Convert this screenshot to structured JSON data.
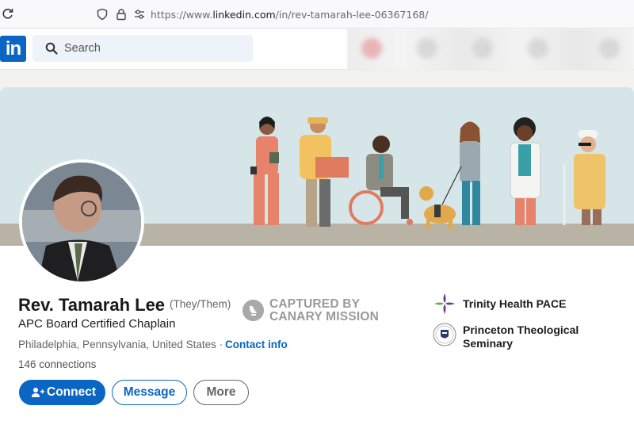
{
  "browser": {
    "url_prefix": "https://www.",
    "url_domain": "linkedin.com",
    "url_path": "/in/rev-tamarah-lee-06367168/"
  },
  "header": {
    "logo_text": "in",
    "search_placeholder": "Search",
    "brand_color": "#0a66c2"
  },
  "profile": {
    "name": "Rev. Tamarah Lee",
    "pronouns": "(They/Them)",
    "headline": "APC Board Certified Chaplain",
    "location": "Philadelphia, Pennsylvania, United States ·",
    "contact_link": "Contact info",
    "connections": "146 connections"
  },
  "stamp": {
    "line1": "CAPTURED BY",
    "line2": "CANARY MISSION"
  },
  "organizations": [
    {
      "line1": "Trinity Health PACE",
      "line2": "",
      "icon": "trinity-health-logo"
    },
    {
      "line1": "Princeton Theological",
      "line2": "Seminary",
      "icon": "princeton-seal-logo"
    }
  ],
  "actions": {
    "connect_label": "Connect",
    "message_label": "Message",
    "more_label": "More"
  }
}
